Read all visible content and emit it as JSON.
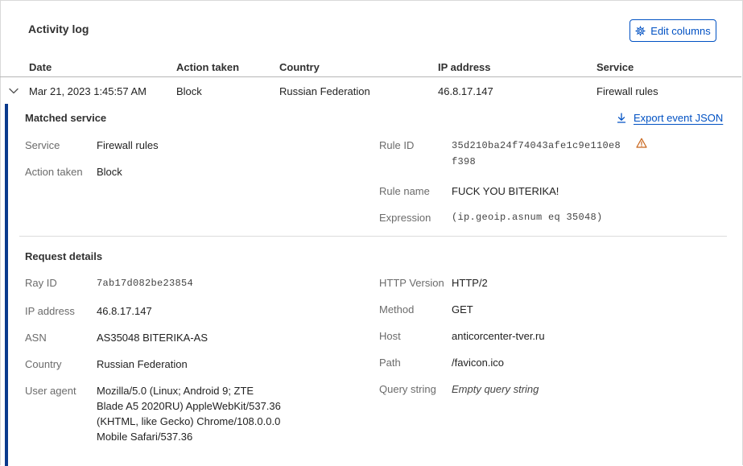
{
  "panel": {
    "title": "Activity log",
    "edit_columns_label": "Edit columns"
  },
  "table": {
    "columns": [
      "Date",
      "Action taken",
      "Country",
      "IP address",
      "Service"
    ],
    "row": {
      "date": "Mar 21, 2023 1:45:57 AM",
      "action": "Block",
      "country": "Russian Federation",
      "ip": "46.8.17.147",
      "service": "Firewall rules"
    }
  },
  "matched_service": {
    "title": "Matched service",
    "export_label": "Export event JSON",
    "service_label": "Service",
    "service_value": "Firewall rules",
    "action_label": "Action taken",
    "action_value": "Block",
    "rule_id_label": "Rule ID",
    "rule_id_line1": "35d210ba24f74043afe1c9e110e8",
    "rule_id_line2": "f398",
    "rule_name_label": "Rule name",
    "rule_name_value": "FUCK YOU BITERIKA!",
    "expression_label": "Expression",
    "expression_value": "(ip.geoip.asnum eq 35048)"
  },
  "request_details": {
    "title": "Request details",
    "ray_id_label": "Ray ID",
    "ray_id_value": "7ab17d082be23854",
    "ip_label": "IP address",
    "ip_value": "46.8.17.147",
    "asn_label": "ASN",
    "asn_value": "AS35048 BITERIKA-AS",
    "country_label": "Country",
    "country_value": "Russian Federation",
    "user_agent_label": "User agent",
    "user_agent_lines": [
      "Mozilla/5.0 (Linux; Android 9; ZTE",
      "Blade A5 2020RU) AppleWebKit/537.36",
      "(KHTML, like Gecko) Chrome/108.0.0.0",
      "Mobile Safari/537.36"
    ],
    "http_version_label": "HTTP Version",
    "http_version_value": "HTTP/2",
    "method_label": "Method",
    "method_value": "GET",
    "host_label": "Host",
    "host_value": "anticorcenter-tver.ru",
    "path_label": "Path",
    "path_value": "/favicon.ico",
    "query_label": "Query string",
    "query_value": "Empty query string"
  },
  "colors": {
    "accent": "#0051c3",
    "expanded_bar": "#0a3a8c",
    "warning": "#c8651a"
  },
  "icons": {
    "edit_columns": "gear-icon",
    "export": "download-icon",
    "expand": "chevron-down-icon",
    "rule_warning": "warning-icon"
  }
}
